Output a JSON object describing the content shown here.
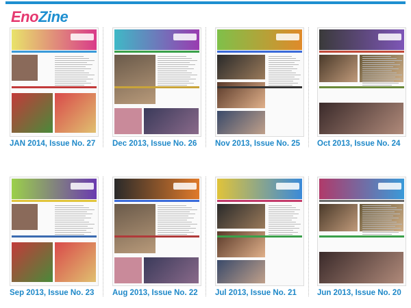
{
  "app": {
    "logo_part1": "Eno",
    "logo_part2": "Zine"
  },
  "colors": {
    "accent": "#1e8fd0",
    "brand_pink": "#e5386f",
    "caption_blue": "#1e88c8"
  },
  "issues": [
    {
      "caption": "JAN 2014, Issue No. 27",
      "scheme": [
        "#e8e36a",
        "#d93b8a",
        "#3a9ad9",
        "#c23a3a"
      ]
    },
    {
      "caption": "Dec 2013, Issue No. 26",
      "scheme": [
        "#3fb9c6",
        "#9a3bb0",
        "#3aa04a",
        "#c9a43a"
      ]
    },
    {
      "caption": "Nov 2013, Issue No. 25",
      "scheme": [
        "#7fc04a",
        "#e08a2a",
        "#3a6ad9",
        "#333333"
      ]
    },
    {
      "caption": "Oct 2013, Issue No. 24",
      "scheme": [
        "#3a3a3a",
        "#7e56b8",
        "#c24a3a",
        "#6a8a3a"
      ]
    },
    {
      "caption": "Sep 2013, Issue No. 23",
      "scheme": [
        "#9bd04a",
        "#6a3ab0",
        "#e0c33a",
        "#3a6ab0"
      ]
    },
    {
      "caption": "Aug 2013, Issue No. 22",
      "scheme": [
        "#2a2a2a",
        "#e07a2a",
        "#3a6ad9",
        "#b03a3a"
      ]
    },
    {
      "caption": "Jul 2013, Issue No. 21",
      "scheme": [
        "#e0c33a",
        "#3a8ad9",
        "#c23a6a",
        "#3aa04a"
      ]
    },
    {
      "caption": "Jun 2013, Issue No. 20",
      "scheme": [
        "#b03a6a",
        "#3a9ad9",
        "#6a6a6a",
        "#3aa04a"
      ]
    }
  ]
}
